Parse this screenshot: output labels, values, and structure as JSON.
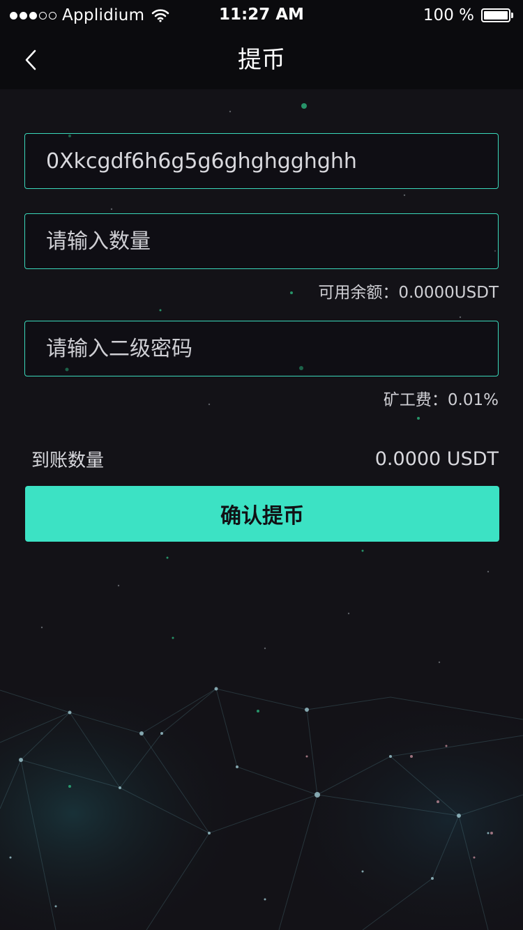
{
  "status_bar": {
    "carrier": "Applidium",
    "time": "11:27 AM",
    "battery": "100 %",
    "signal_bars_filled": 3,
    "signal_bars_total": 5,
    "battery_level": 1.0
  },
  "nav": {
    "title": "提币",
    "back_icon": "chevron-left-icon"
  },
  "form": {
    "address": {
      "value": "0Xkcgdf6h6g5g6ghghgghghh"
    },
    "amount": {
      "placeholder": "请输入数量",
      "available_text": "可用余额：0.0000USDT"
    },
    "password": {
      "placeholder": "请输入二级密码",
      "fee_text": "矿工费：0.01%"
    },
    "receive": {
      "label": "到账数量",
      "value": "0.0000 USDT"
    },
    "confirm_label": "确认提币"
  },
  "colors": {
    "background": "#131217",
    "bar": "#0b0b0e",
    "accent": "#3ce2c4",
    "field_border": "#3ad8bb",
    "text": "#d9d9de"
  }
}
